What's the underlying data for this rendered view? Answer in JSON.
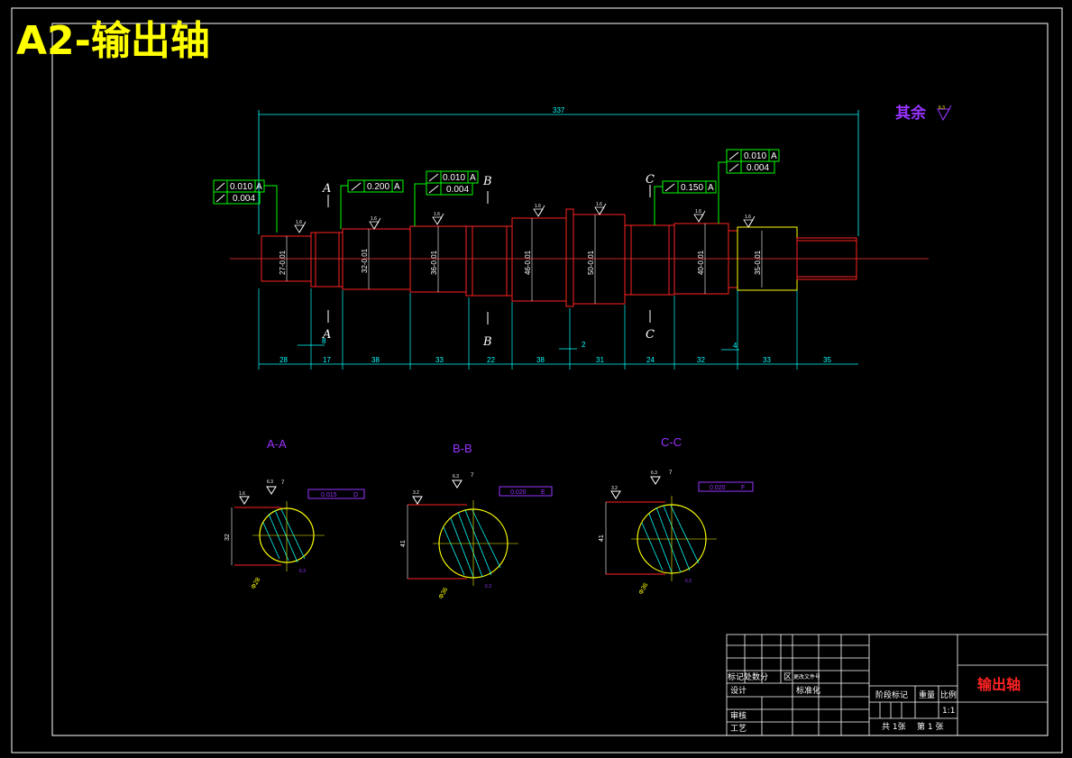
{
  "title": "A2-输出轴",
  "note": {
    "text": "其余",
    "roughness": "6.3"
  },
  "overall_length": "337",
  "segment_dims": [
    "28",
    "17",
    "38",
    "33",
    "22",
    "38",
    "31",
    "24",
    "32",
    "33",
    "35"
  ],
  "small_dims": {
    "shoulder_a": "8",
    "shoulder_b": "2",
    "shoulder_c": "4"
  },
  "diameters": [
    "27-0.01",
    "32-0.01",
    "36-0.01",
    "46-0.01",
    "50-0.01",
    "40-0.01",
    "35-0.01"
  ],
  "roughness_values": [
    "1.6",
    "1.6",
    "1.6",
    "1.6",
    "1.6",
    "1.6",
    "1.6",
    "1.6"
  ],
  "section_markers": {
    "a": "A",
    "b": "B",
    "c": "C"
  },
  "tolerance_frames": [
    {
      "runout": "0.010",
      "datum": "A",
      "circularity": "0.004"
    },
    {
      "runout": "0.200",
      "datum": "A"
    },
    {
      "runout": "0.010",
      "datum": "A",
      "circularity": "0.004"
    },
    {
      "runout": "0.150",
      "datum": "A"
    },
    {
      "runout": "0.010",
      "datum": "A",
      "circularity": "0.004"
    }
  ],
  "sections": [
    {
      "label": "A-A",
      "dim_height": "32",
      "dim_dia": "Φ28",
      "key_w": "7",
      "rough_left": "1.6",
      "rough_top": "6.3",
      "pos_tol": "0.015",
      "datum": "D",
      "bottom_rough": "6.3"
    },
    {
      "label": "B-B",
      "dim_height": "41",
      "dim_dia": "Φ36",
      "key_w": "7",
      "rough_left": "3.2",
      "rough_top": "6.3",
      "pos_tol": "0.020",
      "datum": "E",
      "bottom_rough": "6.3"
    },
    {
      "label": "C-C",
      "dim_height": "41",
      "dim_dia": "Φ36",
      "key_w": "7",
      "rough_left": "3.2",
      "rough_top": "6.3",
      "pos_tol": "0.020",
      "datum": "F",
      "bottom_rough": "6.3"
    }
  ],
  "title_block": {
    "part_name": "输出轴",
    "mark_label": "标记处数分",
    "zone_label": "区",
    "change_label": "更改文件号",
    "design": "设计",
    "standard": "标准化",
    "review": "审核",
    "process": "工艺",
    "stage_mark": "阶段标记",
    "weight": "重量",
    "scale_label": "比例",
    "scale": "1:1",
    "sheets_total": "共 1张",
    "sheet_no": "第 1 张"
  }
}
